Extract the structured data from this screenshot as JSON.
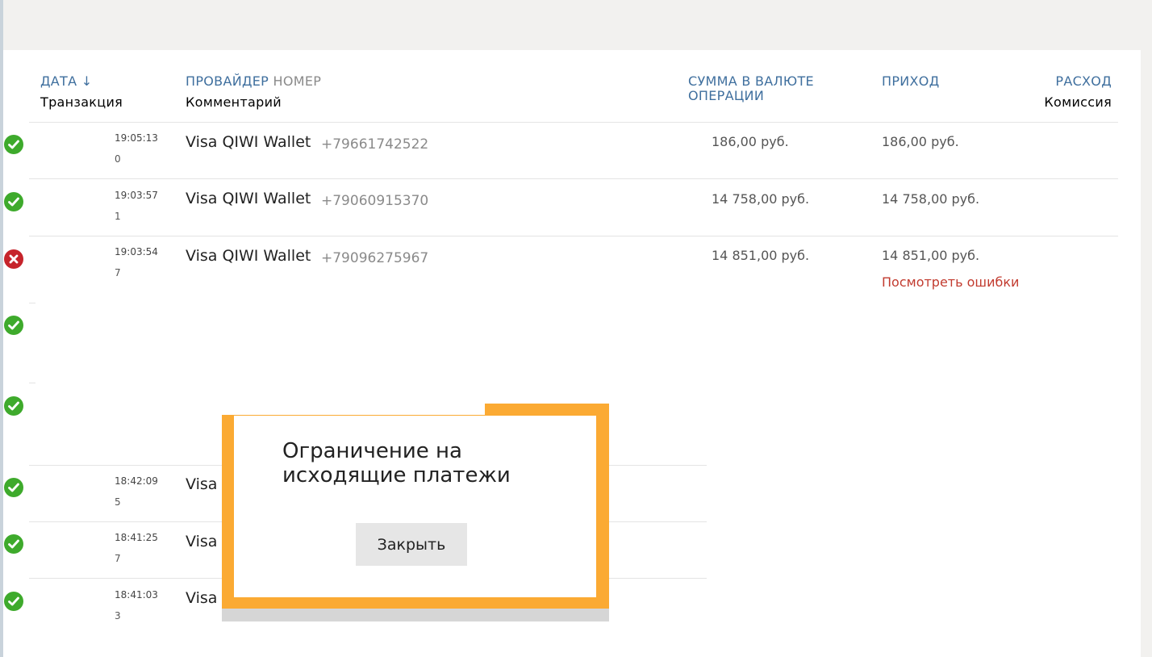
{
  "header": {
    "date_label": "ДАТА",
    "sort_arrow": "↓",
    "transaction_label": "Транзакция",
    "provider_label": "ПРОВАЙДЕР",
    "number_label": "НОМЕР",
    "comment_label": "Комментарий",
    "amount_label_line1": "СУММА В ВАЛЮТЕ",
    "amount_label_line2": "ОПЕРАЦИИ",
    "income_label": "ПРИХОД",
    "expense_label": "РАСХОД",
    "commission_label": "Комиссия"
  },
  "rows": [
    {
      "status": "success",
      "time": "19:05:13",
      "id_fragment": "0",
      "provider": "Visa QIWI Wallet",
      "number": "+79661742522",
      "amount": "186,00 руб.",
      "income": "186,00 руб."
    },
    {
      "status": "success",
      "time": "19:03:57",
      "id_fragment": "1",
      "provider": "Visa QIWI Wallet",
      "number": "+79060915370",
      "amount": "14 758,00 руб.",
      "income": "14 758,00 руб."
    },
    {
      "status": "error",
      "time": "19:03:54",
      "id_fragment": "7",
      "provider": "Visa QIWI Wallet",
      "number": "+79096275967",
      "amount": "14 851,00 руб.",
      "income": "14 851,00 руб.",
      "error_link": "Посмотреть ошибки"
    },
    {
      "status": "success"
    },
    {
      "status": "success"
    },
    {
      "status": "success",
      "time": "18:42:09",
      "id_fragment": "5",
      "provider": "Visa"
    },
    {
      "status": "success",
      "time": "18:41:25",
      "id_fragment": "7",
      "provider": "Visa"
    },
    {
      "status": "success",
      "time": "18:41:03",
      "id_fragment": "3",
      "provider": "Visa"
    }
  ],
  "modal": {
    "title": "Ограничение на исходящие платежи",
    "close_label": "Закрыть"
  },
  "colors": {
    "link_blue": "#3f6f9e",
    "success_green": "#3eaa2c",
    "error_red": "#c6242b",
    "error_link": "#c23b2f",
    "modal_accent": "#fbaa33"
  }
}
